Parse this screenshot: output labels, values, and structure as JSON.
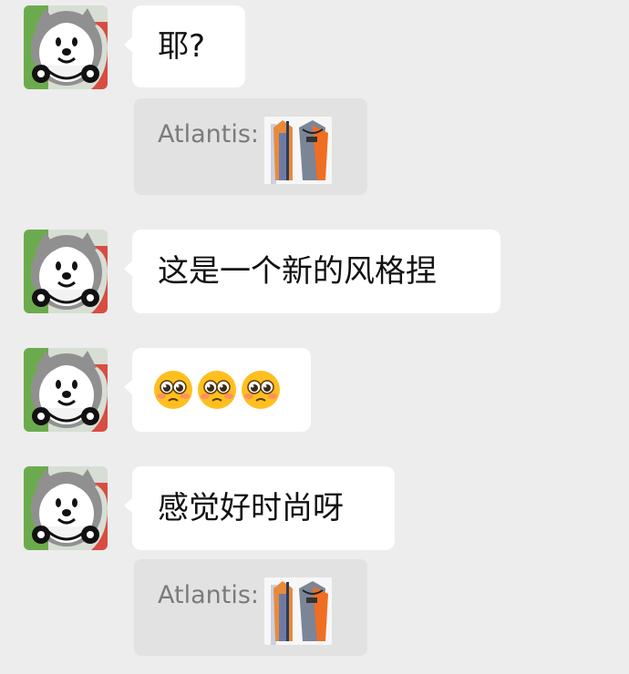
{
  "messages": [
    {
      "type": "text",
      "text": "耶?"
    },
    {
      "type": "quote",
      "author": "Atlantis:",
      "thumbnail": "clothing-thumbnail-icon"
    },
    {
      "type": "text",
      "text": "这是一个新的风格捏"
    },
    {
      "type": "emoji",
      "emoji_count": 3,
      "emoji_name": "pleading-face-icon"
    },
    {
      "type": "text",
      "text": "感觉好时尚呀"
    },
    {
      "type": "quote",
      "author": "Atlantis:",
      "thumbnail": "clothing-thumbnail-icon"
    }
  ],
  "colors": {
    "background": "#ededed",
    "bubble": "#ffffff",
    "quote": "#e2e2e2",
    "quote_text": "#7b7b7b",
    "avatar_green": "#6cab4d",
    "avatar_red": "#d84d42",
    "emoji_yellow": "#ffbf1f"
  }
}
